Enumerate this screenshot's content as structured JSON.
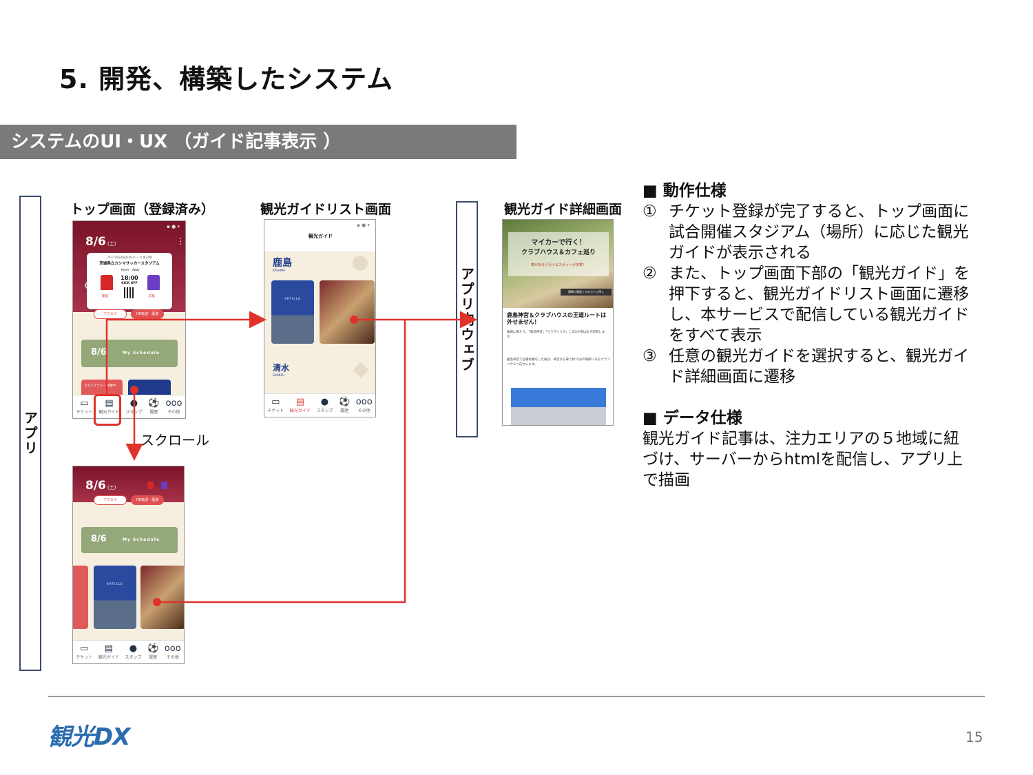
{
  "slide": {
    "title": "5. 開発、構築したシステム",
    "section": "システムのUI・UX （ガイド記事表示 ）",
    "page_number": "15"
  },
  "labels": {
    "app": "アプリ",
    "in_app_web": "アプリ内ウェブ",
    "top_screen": "トップ画面（登録済み）",
    "guide_list_screen": "観光ガイドリスト画面",
    "guide_detail_screen": "観光ガイド詳細画面",
    "scroll": "スクロール"
  },
  "top_screen": {
    "date": "8/6",
    "weekday": "(土)",
    "league": "2022 明治安田生命J1リーグ 第24節",
    "stadium": "茨城県立カシマサッカースタジアム",
    "home": "Home",
    "away": "Away",
    "kickoff_time": "18:00",
    "kickoff_label": "KICK OFF",
    "home_team": "鹿島",
    "away_team": "広島",
    "access_button": "アクセス",
    "qr_button": "QR転送・譲渡",
    "schedule_date": "8/6",
    "schedule_label": "My Schedule",
    "stamp_text": "スタンプラリー 開催中"
  },
  "guide_list": {
    "header": "観光ガイド",
    "area1": "鹿島",
    "area1_en": "KASHIMA",
    "area2": "清水",
    "area2_en": "SHIMIZU",
    "card_label": "ARTICLE"
  },
  "guide_detail": {
    "hero_line1": "マイカーで行く！",
    "hero_line2": "クラブハウス＆カフェ巡り",
    "hero_sub": "車があると行けるスポットが多数！",
    "hero_caption": "鹿嶋で最愛入りのカフェ探し",
    "article_title": "鹿島神宮＆クラブハウスの王道ルートは外せません！",
    "body1": "鹿嶋に来たら、「鹿島神宮」「クラブハウス」この2か所は必ず訪問します。",
    "body2": "鹿島神宮で必勝祈願をした後は、神宮から車で約15分の場所にあるクラブハウスへ向かいます。"
  },
  "tabs": [
    {
      "icon": "▭",
      "label": "チケット"
    },
    {
      "icon": "▤",
      "label": "観光ガイド"
    },
    {
      "icon": "●",
      "label": "スタンプ"
    },
    {
      "icon": "⚽",
      "label": "履歴"
    },
    {
      "icon": "ooo",
      "label": "その他"
    }
  ],
  "spec": {
    "motion_heading": "■ 動作仕様",
    "items": [
      {
        "num": "①",
        "lines": [
          "チケット登録が完了すると、トップ画面に",
          "試合開催スタジアム（場所）に応じた観光",
          "ガイドが表示される"
        ]
      },
      {
        "num": "②",
        "lines": [
          "また、トップ画面下部の「観光ガイド」を",
          "押下すると、観光ガイドリスト画面に遷移",
          "し、本サービスで配信している観光ガイド",
          "をすべて表示"
        ]
      },
      {
        "num": "③",
        "lines": [
          "任意の観光ガイドを選択すると、観光ガイ",
          "ド詳細画面に遷移"
        ]
      }
    ],
    "data_heading": "■ データ仕様",
    "data_lines": [
      "観光ガイド記事は、注力エリアの５地域に紐",
      "づけ、サーバーからhtmlを配信し、アプリ上",
      "で描画"
    ]
  },
  "logo": {
    "text": "観光DX"
  },
  "colors": {
    "accent_red": "#e0322b",
    "section_gray": "#7a7a7a",
    "app_maroon": "#8b1e32",
    "app_green": "#94a87a",
    "app_cream": "#f6efe0",
    "app_navy": "#1f3a8a"
  }
}
